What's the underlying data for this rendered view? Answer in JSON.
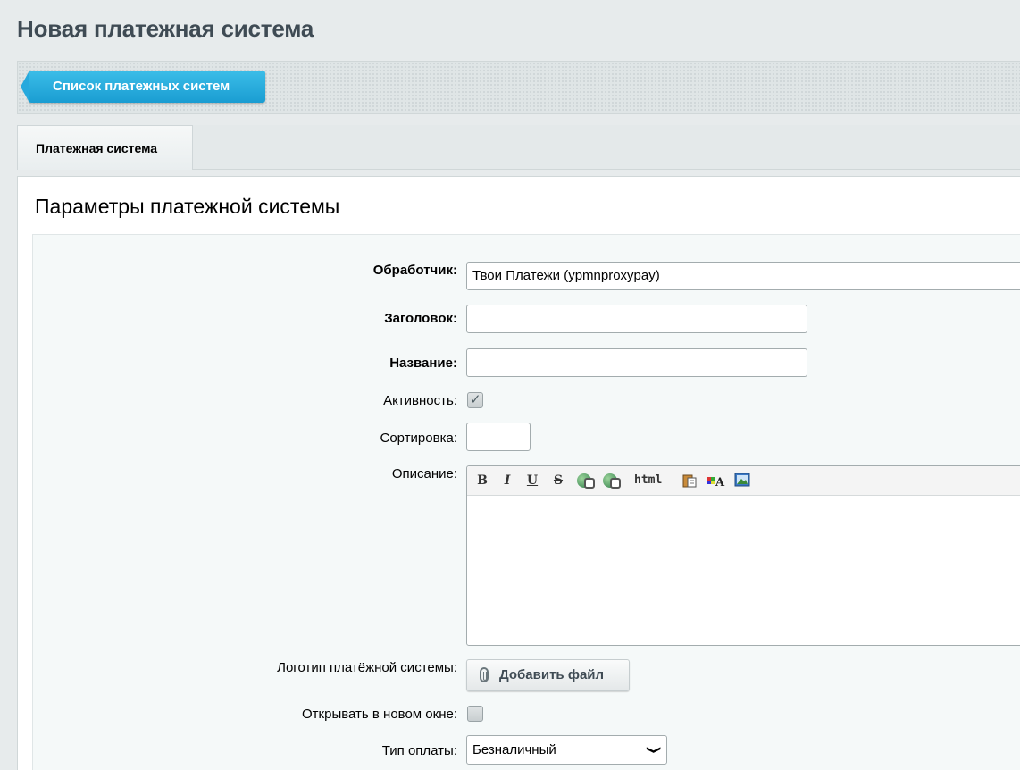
{
  "page": {
    "title": "Новая платежная система"
  },
  "toolbar": {
    "back_label": "Список платежных систем"
  },
  "tabs": [
    {
      "label": "Платежная система"
    }
  ],
  "section": {
    "title": "Параметры платежной системы"
  },
  "form": {
    "handler": {
      "label": "Обработчик:",
      "value": "Твои Платежи (ypmnproxypay)"
    },
    "heading": {
      "label": "Заголовок:",
      "value": ""
    },
    "name": {
      "label": "Название:",
      "value": ""
    },
    "active": {
      "label": "Активность:",
      "checked": true
    },
    "sort": {
      "label": "Сортировка:",
      "value": ""
    },
    "description": {
      "label": "Описание:",
      "toolbar": {
        "bold": "B",
        "italic": "I",
        "underline": "U",
        "strike": "S",
        "html": "html",
        "icons": [
          "bold-icon",
          "italic-icon",
          "underline-icon",
          "strike-icon",
          "insert-link-icon",
          "remove-link-icon",
          "html-icon",
          "paste-icon",
          "font-icon",
          "image-icon"
        ]
      },
      "value": ""
    },
    "logo": {
      "label": "Логотип платёжной системы:",
      "button": "Добавить файл"
    },
    "new_window": {
      "label": "Открывать в новом окне:",
      "checked": false
    },
    "payment_type": {
      "label": "Тип оплаты:",
      "value": "Безналичный"
    }
  },
  "colors": {
    "accent": "#1fa7de",
    "title": "#3f4b54",
    "background": "#e7ebec"
  }
}
